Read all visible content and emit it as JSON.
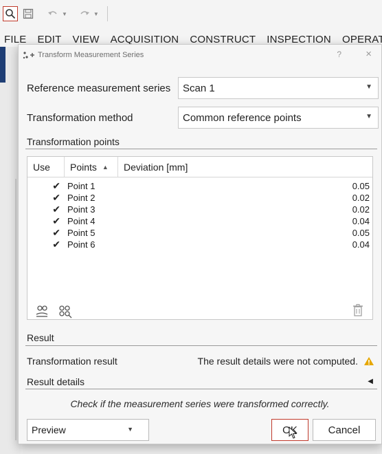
{
  "menubar": {
    "items": [
      "FILE",
      "EDIT",
      "VIEW",
      "ACQUISITION",
      "CONSTRUCT",
      "INSPECTION",
      "OPERAT"
    ]
  },
  "dialog": {
    "title": "Transform Measurement Series",
    "help": "?",
    "close": "×",
    "reference_label": "Reference measurement series",
    "reference_value": "Scan 1",
    "method_label": "Transformation method",
    "method_value": "Common reference points",
    "points_section": "Transformation points",
    "table": {
      "headers": [
        "Use",
        "Points",
        "Deviation [mm]"
      ],
      "rows": [
        {
          "use": true,
          "point": "Point 1",
          "deviation": "0.05"
        },
        {
          "use": true,
          "point": "Point 2",
          "deviation": "0.02"
        },
        {
          "use": true,
          "point": "Point 3",
          "deviation": "0.02"
        },
        {
          "use": true,
          "point": "Point 4",
          "deviation": "0.04"
        },
        {
          "use": true,
          "point": "Point 5",
          "deviation": "0.05"
        },
        {
          "use": true,
          "point": "Point 6",
          "deviation": "0.04"
        }
      ]
    },
    "result_section": "Result",
    "result_label": "Transformation result",
    "result_value": "The result details were not computed.",
    "result_details_label": "Result details",
    "hint": "Check if the measurement series were transformed correctly.",
    "preview_value": "Preview",
    "ok_label": "OK",
    "cancel_label": "Cancel"
  },
  "colors": {
    "warning": "#e6a700",
    "menubar_accent": "#1f3e75",
    "ok_focus_border": "#c0392b"
  },
  "icons": {
    "title": "transform-points-icon",
    "add_point": "add-point-icon",
    "find_points": "find-points-icon",
    "delete": "trash-icon",
    "warning": "warning-icon"
  }
}
